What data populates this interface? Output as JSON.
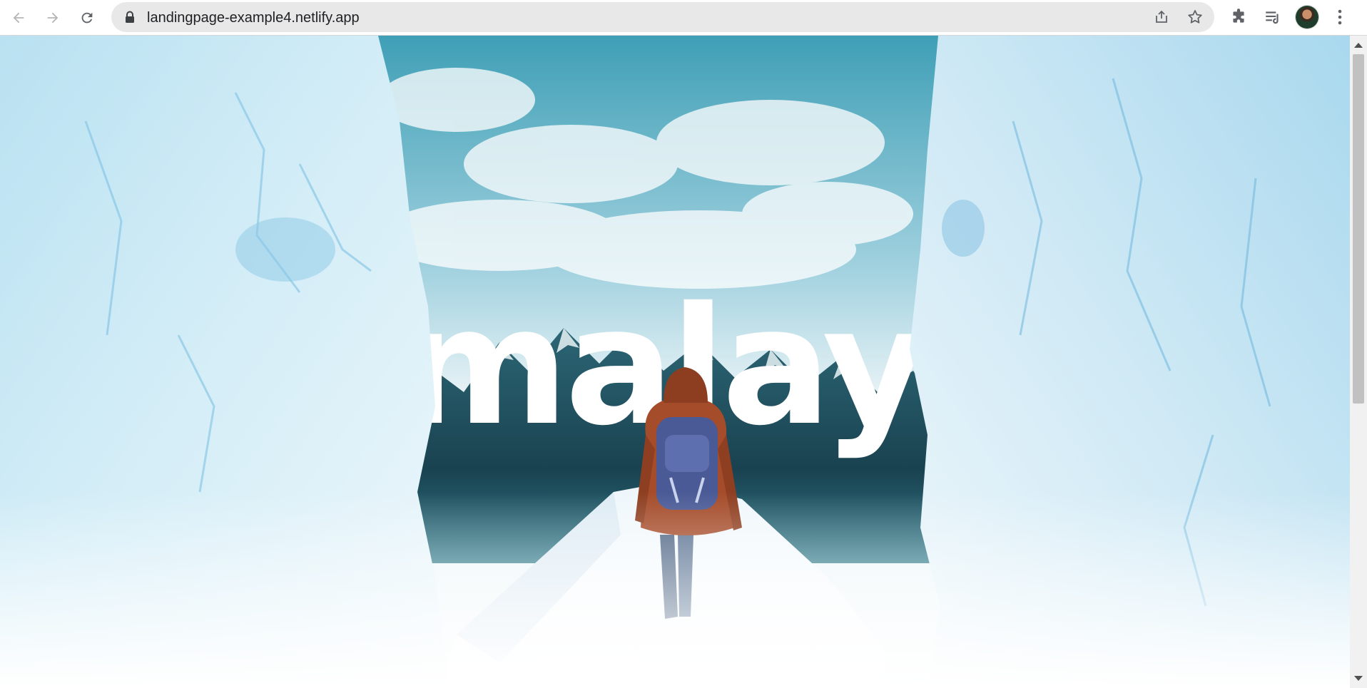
{
  "browser": {
    "url": "landingpage-example4.netlify.app",
    "icons": {
      "back": "back-arrow-icon",
      "forward": "forward-arrow-icon",
      "reload": "reload-icon",
      "lock": "lock-icon",
      "share": "share-icon",
      "bookmark": "star-icon",
      "extensions": "puzzle-icon",
      "media": "media-queue-icon",
      "menu": "kebab-menu-icon"
    }
  },
  "hero": {
    "headline_fragment": "malay",
    "colors": {
      "ice": "#cfeaf6",
      "sky": "#7fc0d6",
      "mountain": "#1f4d5c",
      "jacket": "#a54c2a",
      "backpack": "#4a5a96"
    }
  }
}
